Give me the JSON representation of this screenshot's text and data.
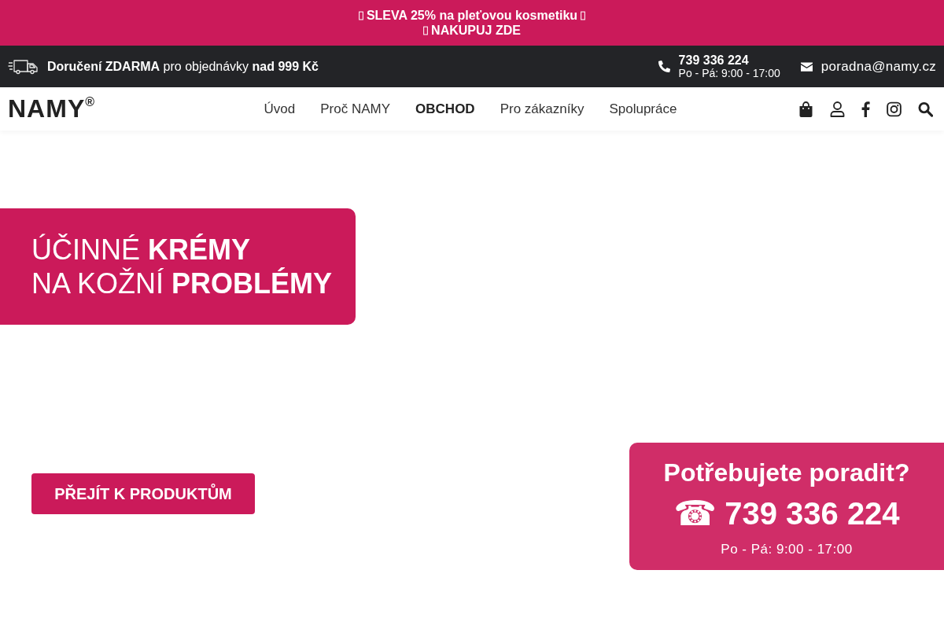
{
  "promo_banner": {
    "lines": [
      "SLEVA 25% na pleťovou kosmetiku",
      "NAKUPUJ ZDE"
    ]
  },
  "top_bar": {
    "delivery": "**Doručení ZDARMA** pro objednávky **nad 999 Kč**",
    "phone": "739 336 224",
    "hours": "Po - Pá: 9:00 - 17:00",
    "email": "poradna@namy.cz"
  },
  "nav": {
    "logo": "NAMY$^{®}$",
    "links": [
      {
        "label": "Úvod",
        "selected": false
      },
      {
        "label": "Proč NAMY",
        "selected": false
      },
      {
        "label": "OBCHOD",
        "selected": true
      },
      {
        "label": "Pro zákazníky",
        "selected": false
      },
      {
        "label": "Spolupráce",
        "selected": false
      }
    ]
  },
  "hero": {
    "heading_lines": [
      "ÚČINNÉ **KRÉMY**",
      "NA KOŽNÍ **PROBLÉMY**"
    ],
    "button": "PŘEJÍT K PRODUKTŮM"
  },
  "callout": {
    "title": "Potřebujete poradit?",
    "phone_icon": "☎",
    "phone": "739 336 224",
    "hours": "Po - Pá: 9:00 - 17:00"
  }
}
